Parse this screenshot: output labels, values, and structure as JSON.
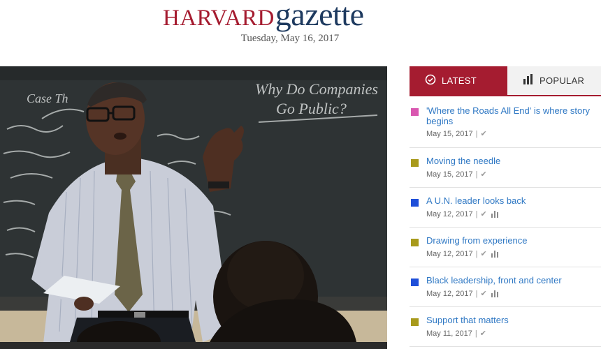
{
  "masthead": {
    "logo_harvard": "HARVARD",
    "logo_gazette": "gazette",
    "date": "Tuesday, May 16, 2017"
  },
  "tabs": {
    "latest": "LATEST",
    "popular": "POPULAR"
  },
  "articles": [
    {
      "title": "'Where the Roads All End' is where story begins",
      "date": "May 15, 2017",
      "color": "#d957b0",
      "has_chart": false
    },
    {
      "title": "Moving the needle",
      "date": "May 15, 2017",
      "color": "#a89a1c",
      "has_chart": false
    },
    {
      "title": "A U.N. leader looks back",
      "date": "May 12, 2017",
      "color": "#1f4fd9",
      "has_chart": true
    },
    {
      "title": "Drawing from experience",
      "date": "May 12, 2017",
      "color": "#a89a1c",
      "has_chart": true
    },
    {
      "title": "Black leadership, front and center",
      "date": "May 12, 2017",
      "color": "#1f4fd9",
      "has_chart": true
    },
    {
      "title": "Support that matters",
      "date": "May 11, 2017",
      "color": "#a89a1c",
      "has_chart": false
    }
  ],
  "hero": {
    "board_text": [
      "Why Do Companies",
      "Go Public?",
      "Case Th"
    ]
  },
  "colors": {
    "crimson": "#a51c30",
    "navy": "#1e3a5f",
    "link": "#2f78c4"
  }
}
